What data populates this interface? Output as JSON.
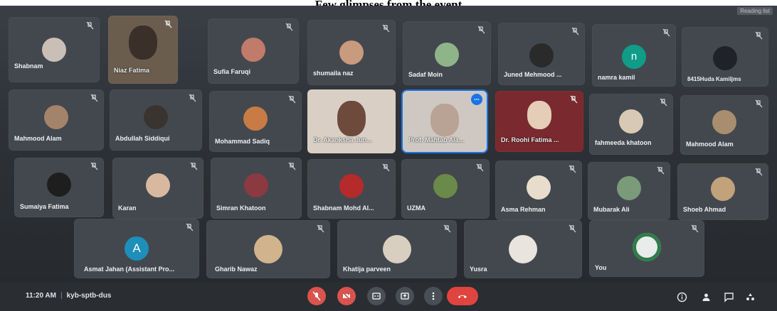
{
  "caption": "Few glimpses from the event",
  "reading_mode": "Reading list",
  "meeting": {
    "time": "11:20 AM",
    "separator": "|",
    "code": "kyb-sptb-dus"
  },
  "participants": [
    {
      "name": "Shabnam"
    },
    {
      "name": "Niaz Fatima"
    },
    {
      "name": "Sufia Faruqi"
    },
    {
      "name": "shumaila naz"
    },
    {
      "name": "Sadaf Moin"
    },
    {
      "name": "Juned Mehmood ..."
    },
    {
      "name": "namra kamil",
      "initial": "n"
    },
    {
      "name": "8415Huda Kamiljms"
    },
    {
      "name": "Mahmood Alam"
    },
    {
      "name": "Abdullah Siddiqui"
    },
    {
      "name": "Mohammad Sadiq"
    },
    {
      "name": "Dr. Akanksha Jun..."
    },
    {
      "name": "Prof. Mahtab Ala..."
    },
    {
      "name": "Dr. Roohi Fatima ..."
    },
    {
      "name": "fahmeeda khatoon"
    },
    {
      "name": "Mahmood Alam"
    },
    {
      "name": "Sumaiya Fatima"
    },
    {
      "name": "Karan"
    },
    {
      "name": "Simran Khatoon"
    },
    {
      "name": "Shabnam Mohd Al..."
    },
    {
      "name": "UZMA"
    },
    {
      "name": "Asma Rehman"
    },
    {
      "name": "Mubarak Ali"
    },
    {
      "name": "Shoeb Ahmad"
    },
    {
      "name": "Asmat Jahan (Assistant Pro...",
      "initial": "A"
    },
    {
      "name": "Gharib Nawaz"
    },
    {
      "name": "Khatija parveen"
    },
    {
      "name": "Yusra"
    },
    {
      "name": "You"
    }
  ],
  "colors": {
    "accent_blue": "#1a73e8",
    "leave_red": "#e0443e",
    "tile_bg": "#43484f"
  }
}
